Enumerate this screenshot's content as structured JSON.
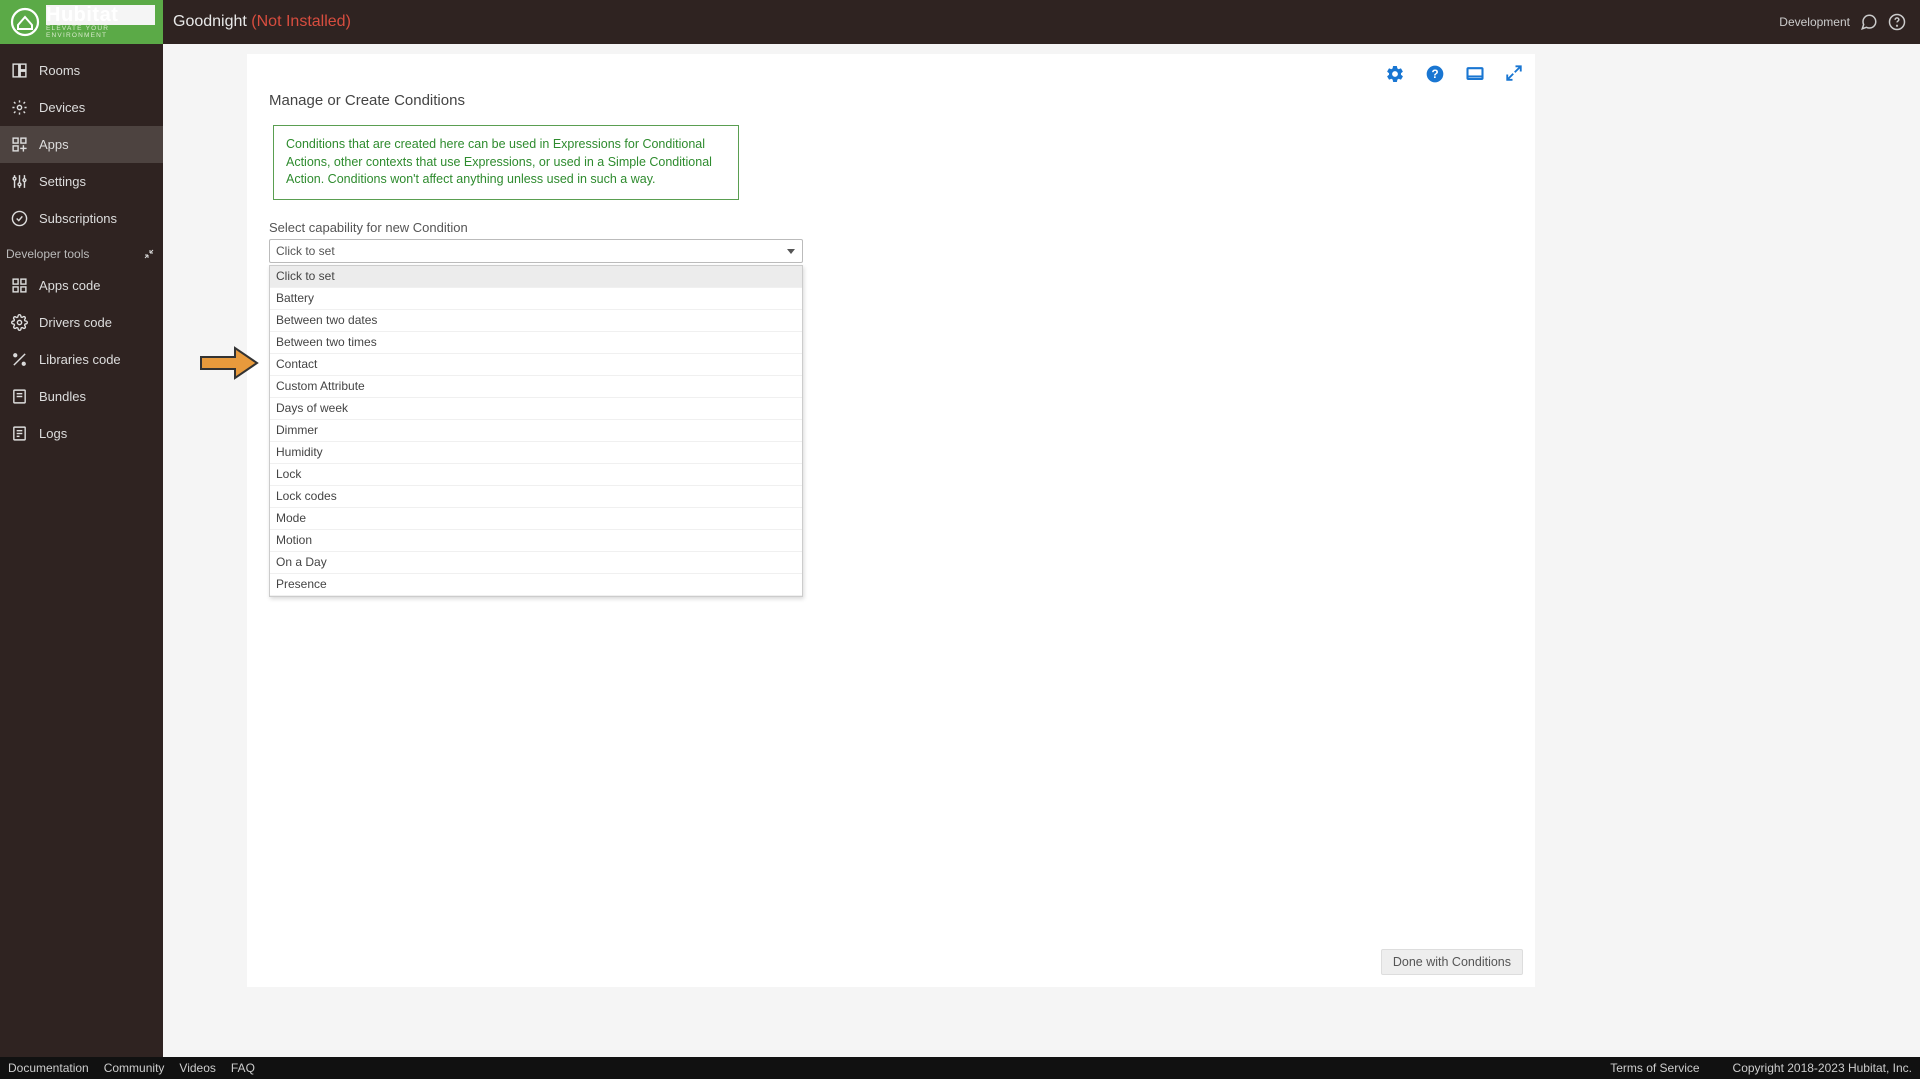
{
  "header": {
    "logo_main": "Hubitat",
    "logo_sub": "ELEVATE YOUR ENVIRONMENT",
    "title": "Goodnight",
    "status": "(Not Installed)",
    "dev_label": "Development"
  },
  "sidebar": {
    "items": [
      {
        "label": "Rooms",
        "icon": "rooms-icon"
      },
      {
        "label": "Devices",
        "icon": "devices-icon"
      },
      {
        "label": "Apps",
        "icon": "apps-icon",
        "active": true
      },
      {
        "label": "Settings",
        "icon": "settings-icon"
      },
      {
        "label": "Subscriptions",
        "icon": "subscriptions-icon"
      }
    ],
    "dev_header": "Developer tools",
    "dev_items": [
      {
        "label": "Apps code",
        "icon": "apps-code-icon"
      },
      {
        "label": "Drivers code",
        "icon": "drivers-code-icon"
      },
      {
        "label": "Libraries code",
        "icon": "libraries-code-icon"
      },
      {
        "label": "Bundles",
        "icon": "bundles-icon"
      },
      {
        "label": "Logs",
        "icon": "logs-icon"
      }
    ]
  },
  "main": {
    "section_title": "Manage or Create Conditions",
    "info_text": "Conditions that are created here can be used in Expressions for Conditional Actions, other contexts that use Expressions, or used in a Simple Conditional Action.  Conditions won't affect anything unless used in such a way.",
    "field_label": "Select capability for new Condition",
    "select_current": "Click to set",
    "options": [
      "Click to set",
      "Battery",
      "Between two dates",
      "Between two times",
      "Contact",
      "Custom Attribute",
      "Days of week",
      "Dimmer",
      "Humidity",
      "Lock",
      "Lock codes",
      "Mode",
      "Motion",
      "On a Day",
      "Presence"
    ],
    "done_label": "Done with Conditions"
  },
  "footer": {
    "links": [
      "Documentation",
      "Community",
      "Videos",
      "FAQ"
    ],
    "right": [
      "Terms of Service",
      "Copyright 2018-2023 Hubitat, Inc."
    ]
  }
}
